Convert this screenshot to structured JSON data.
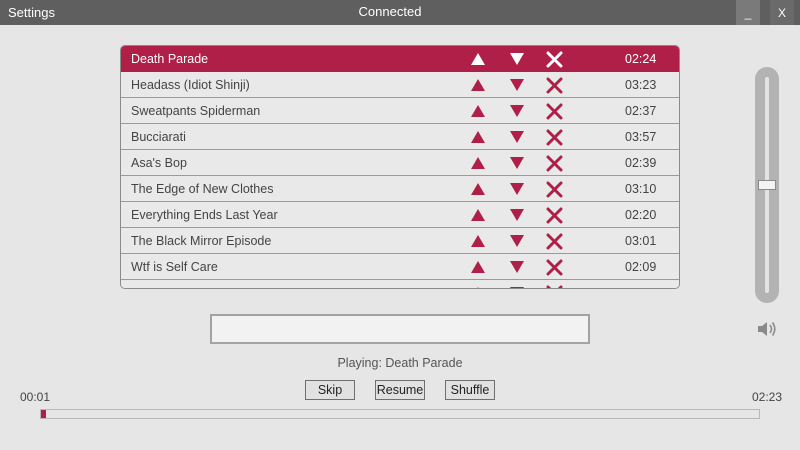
{
  "titlebar": {
    "settings_label": "Settings",
    "status": "Connected",
    "minimize_label": "_",
    "close_label": "X"
  },
  "playlist": {
    "active_index": 0,
    "items": [
      {
        "title": "Death Parade",
        "duration": "02:24"
      },
      {
        "title": "Headass (Idiot Shinji)",
        "duration": "03:23"
      },
      {
        "title": "Sweatpants Spiderman",
        "duration": "02:37"
      },
      {
        "title": "Bucciarati",
        "duration": "03:57"
      },
      {
        "title": "Asa's Bop",
        "duration": "02:39"
      },
      {
        "title": "The Edge of New Clothes",
        "duration": "03:10"
      },
      {
        "title": "Everything Ends Last Year",
        "duration": "02:20"
      },
      {
        "title": "The Black Mirror Episode",
        "duration": "03:01"
      },
      {
        "title": "Wtf is Self Care",
        "duration": "02:09"
      },
      {
        "title": "",
        "duration": ""
      }
    ]
  },
  "volume": {
    "level": 0.5
  },
  "search": {
    "value": "",
    "placeholder": ""
  },
  "now_playing": "Playing: Death Parade",
  "controls": {
    "skip": "Skip",
    "resume": "Resume",
    "shuffle": "Shuffle"
  },
  "progress": {
    "current": "00:01",
    "total": "02:23",
    "fraction": 0.007
  },
  "colors": {
    "accent": "#b01f48",
    "titlebar": "#5f5f5f",
    "background": "#e6e6e6"
  },
  "icons": {
    "up": "triangle-up-icon",
    "down": "triangle-down-icon",
    "remove": "x-icon",
    "volume": "speaker-icon"
  }
}
